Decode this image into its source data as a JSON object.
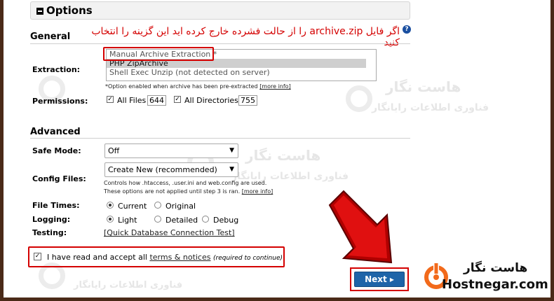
{
  "options": {
    "title": "Options"
  },
  "note": {
    "text": "اگر فایل archive.zip را از حالت فشرده خارج کرده اید این گزینه را انتخاب کنید"
  },
  "general": {
    "heading": "General",
    "extraction": {
      "label": "Extraction:",
      "options": [
        "Manual Archive Extraction *",
        "PHP ZipArchive",
        "Shell Exec Unzip (not detected on server)"
      ],
      "selected": "PHP ZipArchive",
      "note": "*Option enabled when archive has been pre-extracted",
      "more_info": "[more info]"
    },
    "permissions": {
      "label": "Permissions:",
      "all_files_label": "All Files",
      "all_files_value": "644",
      "all_dirs_label": "All Directories",
      "all_dirs_value": "755"
    }
  },
  "advanced": {
    "heading": "Advanced",
    "safe_mode": {
      "label": "Safe Mode:",
      "value": "Off"
    },
    "config_files": {
      "label": "Config Files:",
      "value": "Create New (recommended)",
      "note1": "Controls how .htaccess, .user.ini and web.config are used.",
      "note2": "These options are not applied until step 3 is ran.",
      "more_info": "[more info]"
    },
    "file_times": {
      "label": "File Times:",
      "opt1": "Current",
      "opt2": "Original",
      "selected": "Current"
    },
    "logging": {
      "label": "Logging:",
      "opt1": "Light",
      "opt2": "Detailed",
      "opt3": "Debug",
      "selected": "Light"
    },
    "testing": {
      "label": "Testing:",
      "link": "[Quick Database Connection Test]"
    }
  },
  "accept": {
    "text": "I have read and accept all",
    "link": "terms & notices",
    "required": "(required to continue)",
    "checked": true
  },
  "next_button": {
    "label": "Next"
  },
  "brand": {
    "name_en": "Hostnegar.com",
    "name_fa": "هاست نگار"
  },
  "watermark": {
    "line1": "هاست نگار",
    "line2": "فناوری اطلاعات رایانگار"
  },
  "colors": {
    "accent_red": "#d40000",
    "button_blue": "#1e64a8",
    "brand_orange": "#f26a1b"
  }
}
